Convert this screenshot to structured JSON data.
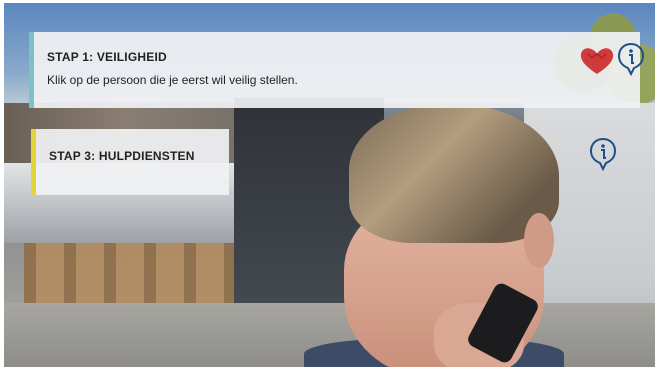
{
  "steps": [
    {
      "title": "STAP 1: VEILIGHEID",
      "instruction": "Klik op de persoon die je eerst wil veilig stellen.",
      "accent_color": "#7cc2c4"
    },
    {
      "title": "STAP 3: HULPDIENSTEN",
      "accent_color": "#e2d53c"
    }
  ],
  "icons": {
    "heart": "heart-icon",
    "heart_color": "#d13a3a",
    "info": "info-icon",
    "info_color": "#1f4e8c"
  }
}
